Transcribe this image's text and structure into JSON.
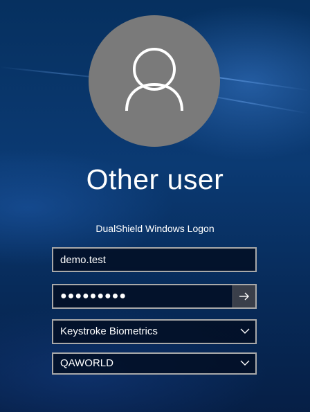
{
  "user": {
    "display_name": "Other user",
    "avatar_icon": "user-silhouette-icon"
  },
  "logon": {
    "provider_title": "DualShield Windows Logon",
    "username_value": "demo.test",
    "password_mask": "●●●●●●●●●",
    "submit_icon": "arrow-right-icon",
    "auth_method": "Keystroke Biometrics",
    "domain": "QAWORLD",
    "dropdown_icon": "chevron-down-icon"
  },
  "colors": {
    "background": "#0a2a57",
    "avatar_circle": "#7a7a7a",
    "field_border": "#a9a9a9",
    "text": "#ffffff"
  }
}
